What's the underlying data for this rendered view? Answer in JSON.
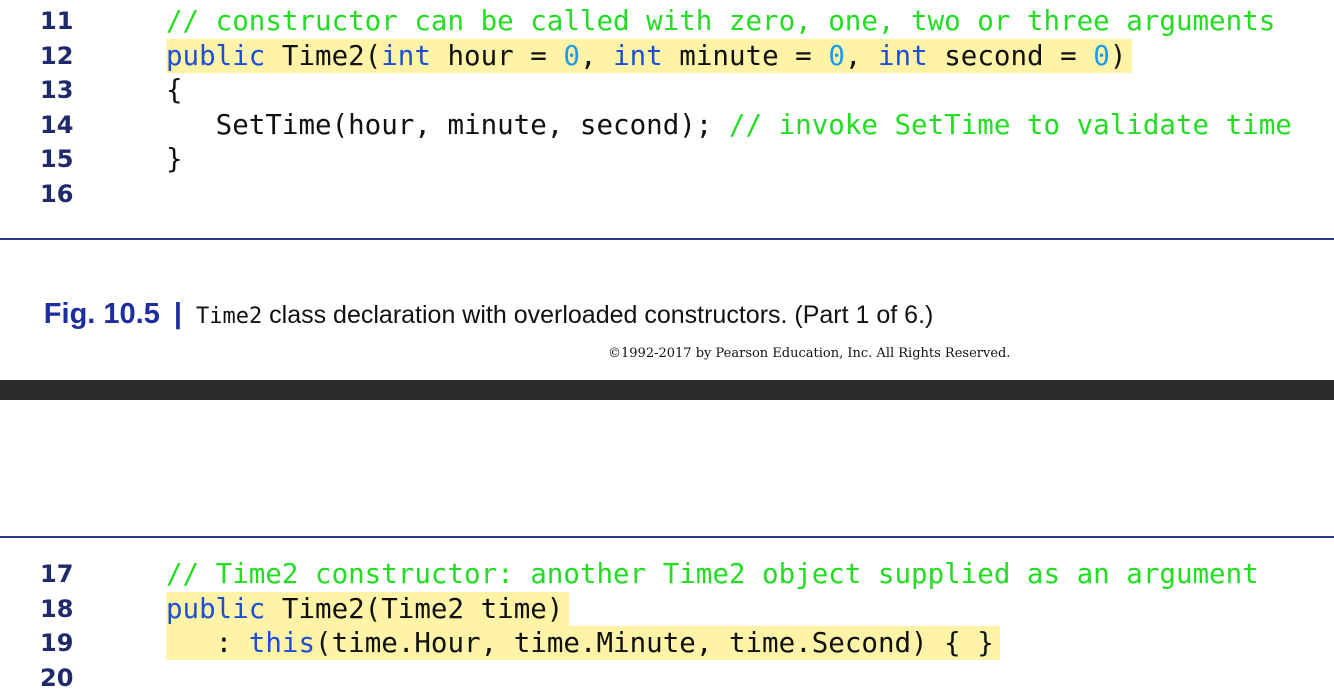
{
  "top": {
    "lines": [
      {
        "n": "11",
        "parts": [
          {
            "cls": "cm",
            "text": "// constructor can be called with zero, one, two or three arguments"
          }
        ]
      },
      {
        "n": "12",
        "hl": true,
        "parts": [
          {
            "cls": "kw",
            "text": "public"
          },
          {
            "text": " Time2("
          },
          {
            "cls": "kw",
            "text": "int"
          },
          {
            "text": " hour = "
          },
          {
            "cls": "num",
            "text": "0"
          },
          {
            "text": ", "
          },
          {
            "cls": "kw",
            "text": "int"
          },
          {
            "text": " minute = "
          },
          {
            "cls": "num",
            "text": "0"
          },
          {
            "text": ", "
          },
          {
            "cls": "kw",
            "text": "int"
          },
          {
            "text": " second = "
          },
          {
            "cls": "num",
            "text": "0"
          },
          {
            "text": ")"
          }
        ]
      },
      {
        "n": "13",
        "parts": [
          {
            "text": "{"
          }
        ]
      },
      {
        "n": "14",
        "parts": [
          {
            "text": "   SetTime(hour, minute, second); "
          },
          {
            "cls": "cm",
            "text": "// invoke SetTime to validate time"
          }
        ]
      },
      {
        "n": "15",
        "parts": [
          {
            "text": "}"
          }
        ]
      },
      {
        "n": "16",
        "parts": []
      }
    ],
    "caption": {
      "label": "Fig. 10.5",
      "sep": "|",
      "code": "Time2",
      "text": " class declaration with overloaded constructors. (Part 1 of 6.)"
    },
    "copyright": "©1992-2017 by Pearson Education, Inc. All Rights Reserved."
  },
  "bottom": {
    "lines": [
      {
        "n": "17",
        "parts": [
          {
            "cls": "cm",
            "text": "// Time2 constructor: another Time2 object supplied as an argument"
          }
        ]
      },
      {
        "n": "18",
        "hl": true,
        "parts": [
          {
            "cls": "kw",
            "text": "public"
          },
          {
            "text": " Time2(Time2 time)"
          }
        ]
      },
      {
        "n": "19",
        "hl": true,
        "parts": [
          {
            "text": "   : "
          },
          {
            "cls": "kw",
            "text": "this"
          },
          {
            "text": "(time.Hour, time.Minute, time.Second) { }"
          }
        ]
      },
      {
        "n": "20",
        "parts": []
      }
    ]
  },
  "colors": {
    "highlight": "#fff3a8",
    "keyword": "#1d4fd6",
    "number": "#1d9bf0",
    "comment": "#22dd22",
    "line_number": "#1f2a6b",
    "figure_label": "#1d2f9e",
    "divider_band": "#2a2a2a"
  }
}
